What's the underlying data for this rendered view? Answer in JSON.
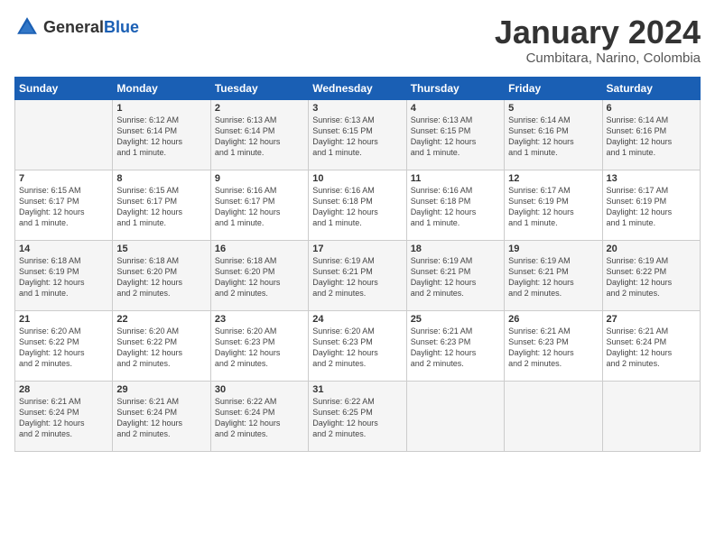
{
  "logo": {
    "general": "General",
    "blue": "Blue"
  },
  "header": {
    "month": "January 2024",
    "location": "Cumbitara, Narino, Colombia"
  },
  "days_of_week": [
    "Sunday",
    "Monday",
    "Tuesday",
    "Wednesday",
    "Thursday",
    "Friday",
    "Saturday"
  ],
  "weeks": [
    [
      {
        "day": "",
        "info": ""
      },
      {
        "day": "1",
        "info": "Sunrise: 6:12 AM\nSunset: 6:14 PM\nDaylight: 12 hours\nand 1 minute."
      },
      {
        "day": "2",
        "info": "Sunrise: 6:13 AM\nSunset: 6:14 PM\nDaylight: 12 hours\nand 1 minute."
      },
      {
        "day": "3",
        "info": "Sunrise: 6:13 AM\nSunset: 6:15 PM\nDaylight: 12 hours\nand 1 minute."
      },
      {
        "day": "4",
        "info": "Sunrise: 6:13 AM\nSunset: 6:15 PM\nDaylight: 12 hours\nand 1 minute."
      },
      {
        "day": "5",
        "info": "Sunrise: 6:14 AM\nSunset: 6:16 PM\nDaylight: 12 hours\nand 1 minute."
      },
      {
        "day": "6",
        "info": "Sunrise: 6:14 AM\nSunset: 6:16 PM\nDaylight: 12 hours\nand 1 minute."
      }
    ],
    [
      {
        "day": "7",
        "info": "Sunrise: 6:15 AM\nSunset: 6:17 PM\nDaylight: 12 hours\nand 1 minute."
      },
      {
        "day": "8",
        "info": "Sunrise: 6:15 AM\nSunset: 6:17 PM\nDaylight: 12 hours\nand 1 minute."
      },
      {
        "day": "9",
        "info": "Sunrise: 6:16 AM\nSunset: 6:17 PM\nDaylight: 12 hours\nand 1 minute."
      },
      {
        "day": "10",
        "info": "Sunrise: 6:16 AM\nSunset: 6:18 PM\nDaylight: 12 hours\nand 1 minute."
      },
      {
        "day": "11",
        "info": "Sunrise: 6:16 AM\nSunset: 6:18 PM\nDaylight: 12 hours\nand 1 minute."
      },
      {
        "day": "12",
        "info": "Sunrise: 6:17 AM\nSunset: 6:19 PM\nDaylight: 12 hours\nand 1 minute."
      },
      {
        "day": "13",
        "info": "Sunrise: 6:17 AM\nSunset: 6:19 PM\nDaylight: 12 hours\nand 1 minute."
      }
    ],
    [
      {
        "day": "14",
        "info": "Sunrise: 6:18 AM\nSunset: 6:19 PM\nDaylight: 12 hours\nand 1 minute."
      },
      {
        "day": "15",
        "info": "Sunrise: 6:18 AM\nSunset: 6:20 PM\nDaylight: 12 hours\nand 2 minutes."
      },
      {
        "day": "16",
        "info": "Sunrise: 6:18 AM\nSunset: 6:20 PM\nDaylight: 12 hours\nand 2 minutes."
      },
      {
        "day": "17",
        "info": "Sunrise: 6:19 AM\nSunset: 6:21 PM\nDaylight: 12 hours\nand 2 minutes."
      },
      {
        "day": "18",
        "info": "Sunrise: 6:19 AM\nSunset: 6:21 PM\nDaylight: 12 hours\nand 2 minutes."
      },
      {
        "day": "19",
        "info": "Sunrise: 6:19 AM\nSunset: 6:21 PM\nDaylight: 12 hours\nand 2 minutes."
      },
      {
        "day": "20",
        "info": "Sunrise: 6:19 AM\nSunset: 6:22 PM\nDaylight: 12 hours\nand 2 minutes."
      }
    ],
    [
      {
        "day": "21",
        "info": "Sunrise: 6:20 AM\nSunset: 6:22 PM\nDaylight: 12 hours\nand 2 minutes."
      },
      {
        "day": "22",
        "info": "Sunrise: 6:20 AM\nSunset: 6:22 PM\nDaylight: 12 hours\nand 2 minutes."
      },
      {
        "day": "23",
        "info": "Sunrise: 6:20 AM\nSunset: 6:23 PM\nDaylight: 12 hours\nand 2 minutes."
      },
      {
        "day": "24",
        "info": "Sunrise: 6:20 AM\nSunset: 6:23 PM\nDaylight: 12 hours\nand 2 minutes."
      },
      {
        "day": "25",
        "info": "Sunrise: 6:21 AM\nSunset: 6:23 PM\nDaylight: 12 hours\nand 2 minutes."
      },
      {
        "day": "26",
        "info": "Sunrise: 6:21 AM\nSunset: 6:23 PM\nDaylight: 12 hours\nand 2 minutes."
      },
      {
        "day": "27",
        "info": "Sunrise: 6:21 AM\nSunset: 6:24 PM\nDaylight: 12 hours\nand 2 minutes."
      }
    ],
    [
      {
        "day": "28",
        "info": "Sunrise: 6:21 AM\nSunset: 6:24 PM\nDaylight: 12 hours\nand 2 minutes."
      },
      {
        "day": "29",
        "info": "Sunrise: 6:21 AM\nSunset: 6:24 PM\nDaylight: 12 hours\nand 2 minutes."
      },
      {
        "day": "30",
        "info": "Sunrise: 6:22 AM\nSunset: 6:24 PM\nDaylight: 12 hours\nand 2 minutes."
      },
      {
        "day": "31",
        "info": "Sunrise: 6:22 AM\nSunset: 6:25 PM\nDaylight: 12 hours\nand 2 minutes."
      },
      {
        "day": "",
        "info": ""
      },
      {
        "day": "",
        "info": ""
      },
      {
        "day": "",
        "info": ""
      }
    ]
  ]
}
